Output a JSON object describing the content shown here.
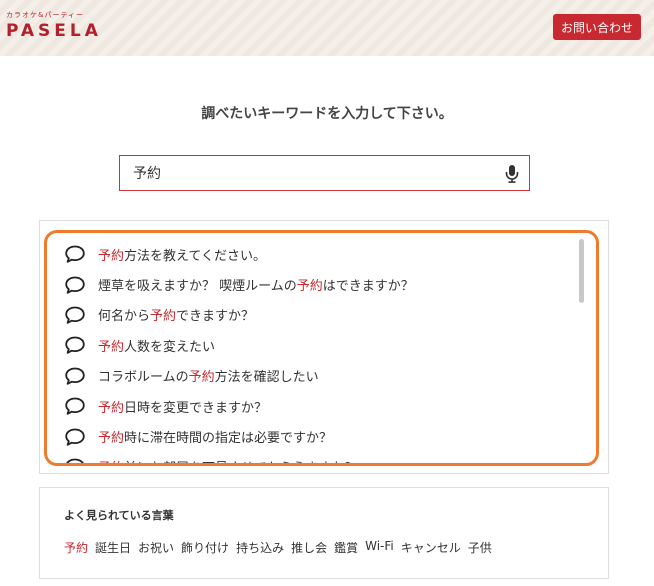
{
  "header": {
    "logo_sub": "カラオケ&パーティー",
    "logo_main": "PASELA",
    "contact_label": "お問い合わせ"
  },
  "heading": "調べたいキーワードを入力して下さい。",
  "search": {
    "value": "予約"
  },
  "suggestions": [
    {
      "pre": "",
      "hl": "予約",
      "post": "方法を教えてください。"
    },
    {
      "pre": "煙草を吸えますか？ 喫煙ルームの",
      "hl": "予約",
      "post": "はできますか？"
    },
    {
      "pre": "何名から",
      "hl": "予約",
      "post": "できますか？"
    },
    {
      "pre": "",
      "hl": "予約",
      "post": "人数を変えたい"
    },
    {
      "pre": "コラボルームの",
      "hl": "予約",
      "post": "方法を確認したい"
    },
    {
      "pre": "",
      "hl": "予約",
      "post": "日時を変更できますか？"
    },
    {
      "pre": "",
      "hl": "予約",
      "post": "時に滞在時間の指定は必要ですか？"
    },
    {
      "pre": "",
      "hl": "予約",
      "post": "前にお部屋を下見させてもらえますか？"
    }
  ],
  "popular": {
    "title": "よく見られている言葉",
    "tags": [
      "予約",
      "誕生日",
      "お祝い",
      "飾り付け",
      "持ち込み",
      "推し会",
      "鑑賞",
      "Wi-Fi",
      "キャンセル",
      "子供"
    ]
  },
  "colors": {
    "brand_red": "#c8282f",
    "focus_orange": "#ee7b2e",
    "header_bg": "#f3ece4"
  }
}
